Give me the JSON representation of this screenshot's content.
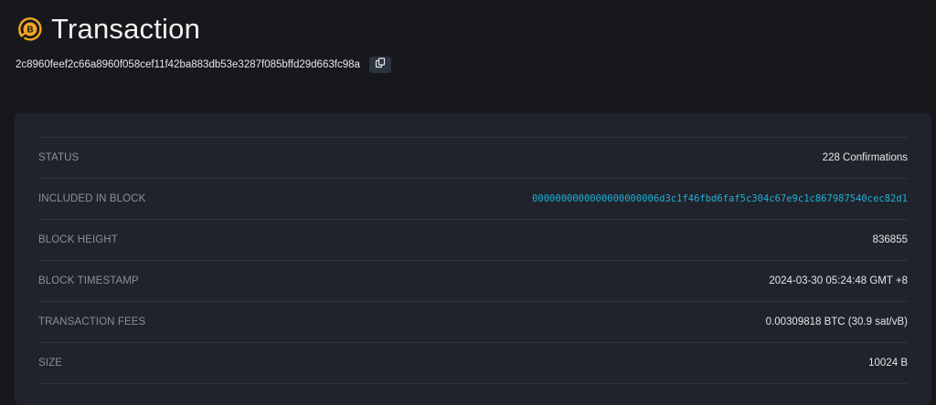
{
  "page": {
    "title": "Transaction",
    "txid": "2c8960feef2c66a8960f058cef11f42ba883db53e3287f085bffd29d663fc98a",
    "icons": {
      "coin": "bitcoin-coin-icon",
      "copy": "copy-icon"
    }
  },
  "colors": {
    "background": "#17181c",
    "panel": "#20232b",
    "accent_orange": "#f5a623",
    "link": "#1fb0d8",
    "label": "#8a8f99"
  },
  "details": {
    "rows": [
      {
        "label": "STATUS",
        "value": "228 Confirmations"
      },
      {
        "label": "INCLUDED IN BLOCK",
        "value": "0000000000000000000006d3c1f46fbd6faf5c304c67e9c1c867987540cec82d1"
      },
      {
        "label": "BLOCK HEIGHT",
        "value": "836855"
      },
      {
        "label": "BLOCK TIMESTAMP",
        "value": "2024-03-30 05:24:48 GMT +8"
      },
      {
        "label": "TRANSACTION FEES",
        "value": "0.00309818 BTC (30.9 sat/vB)"
      },
      {
        "label": "SIZE",
        "value": "10024 B"
      }
    ]
  }
}
